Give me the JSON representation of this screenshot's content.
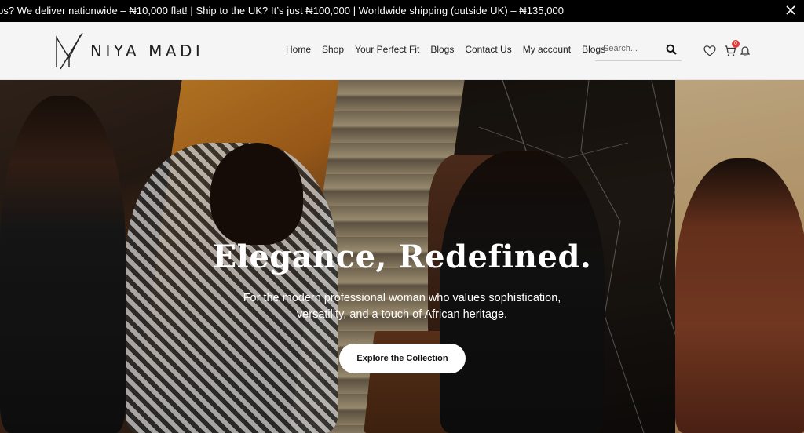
{
  "announcement": {
    "text": "ps? We deliver nationwide – ₦10,000 flat! | Ship to the UK? It’s just ₦100,000 | Worldwide shipping (outside UK) – ₦135,000",
    "close_icon": "close-icon"
  },
  "brand": {
    "name": "NIYA MADI"
  },
  "nav": {
    "items": [
      "Home",
      "Shop",
      "Your Perfect Fit",
      "Blogs",
      "Contact Us",
      "My account",
      "Blogs"
    ]
  },
  "search": {
    "placeholder": "Search...",
    "icon": "search-icon"
  },
  "header_icons": {
    "wishlist": "heart-icon",
    "cart": "cart-icon",
    "cart_count": "0",
    "notifications": "bell-icon"
  },
  "hero": {
    "title": "Elegance, Redefined.",
    "subtitle_line1": "For the modern professional woman who values sophistication,",
    "subtitle_line2": "versatility, and a touch of African heritage.",
    "cta_label": "Explore the Collection"
  },
  "colors": {
    "announcement_bg": "#000000",
    "header_bg": "#f5f5f5",
    "badge": "#e23b3b",
    "cta_bg": "#ffffff"
  }
}
